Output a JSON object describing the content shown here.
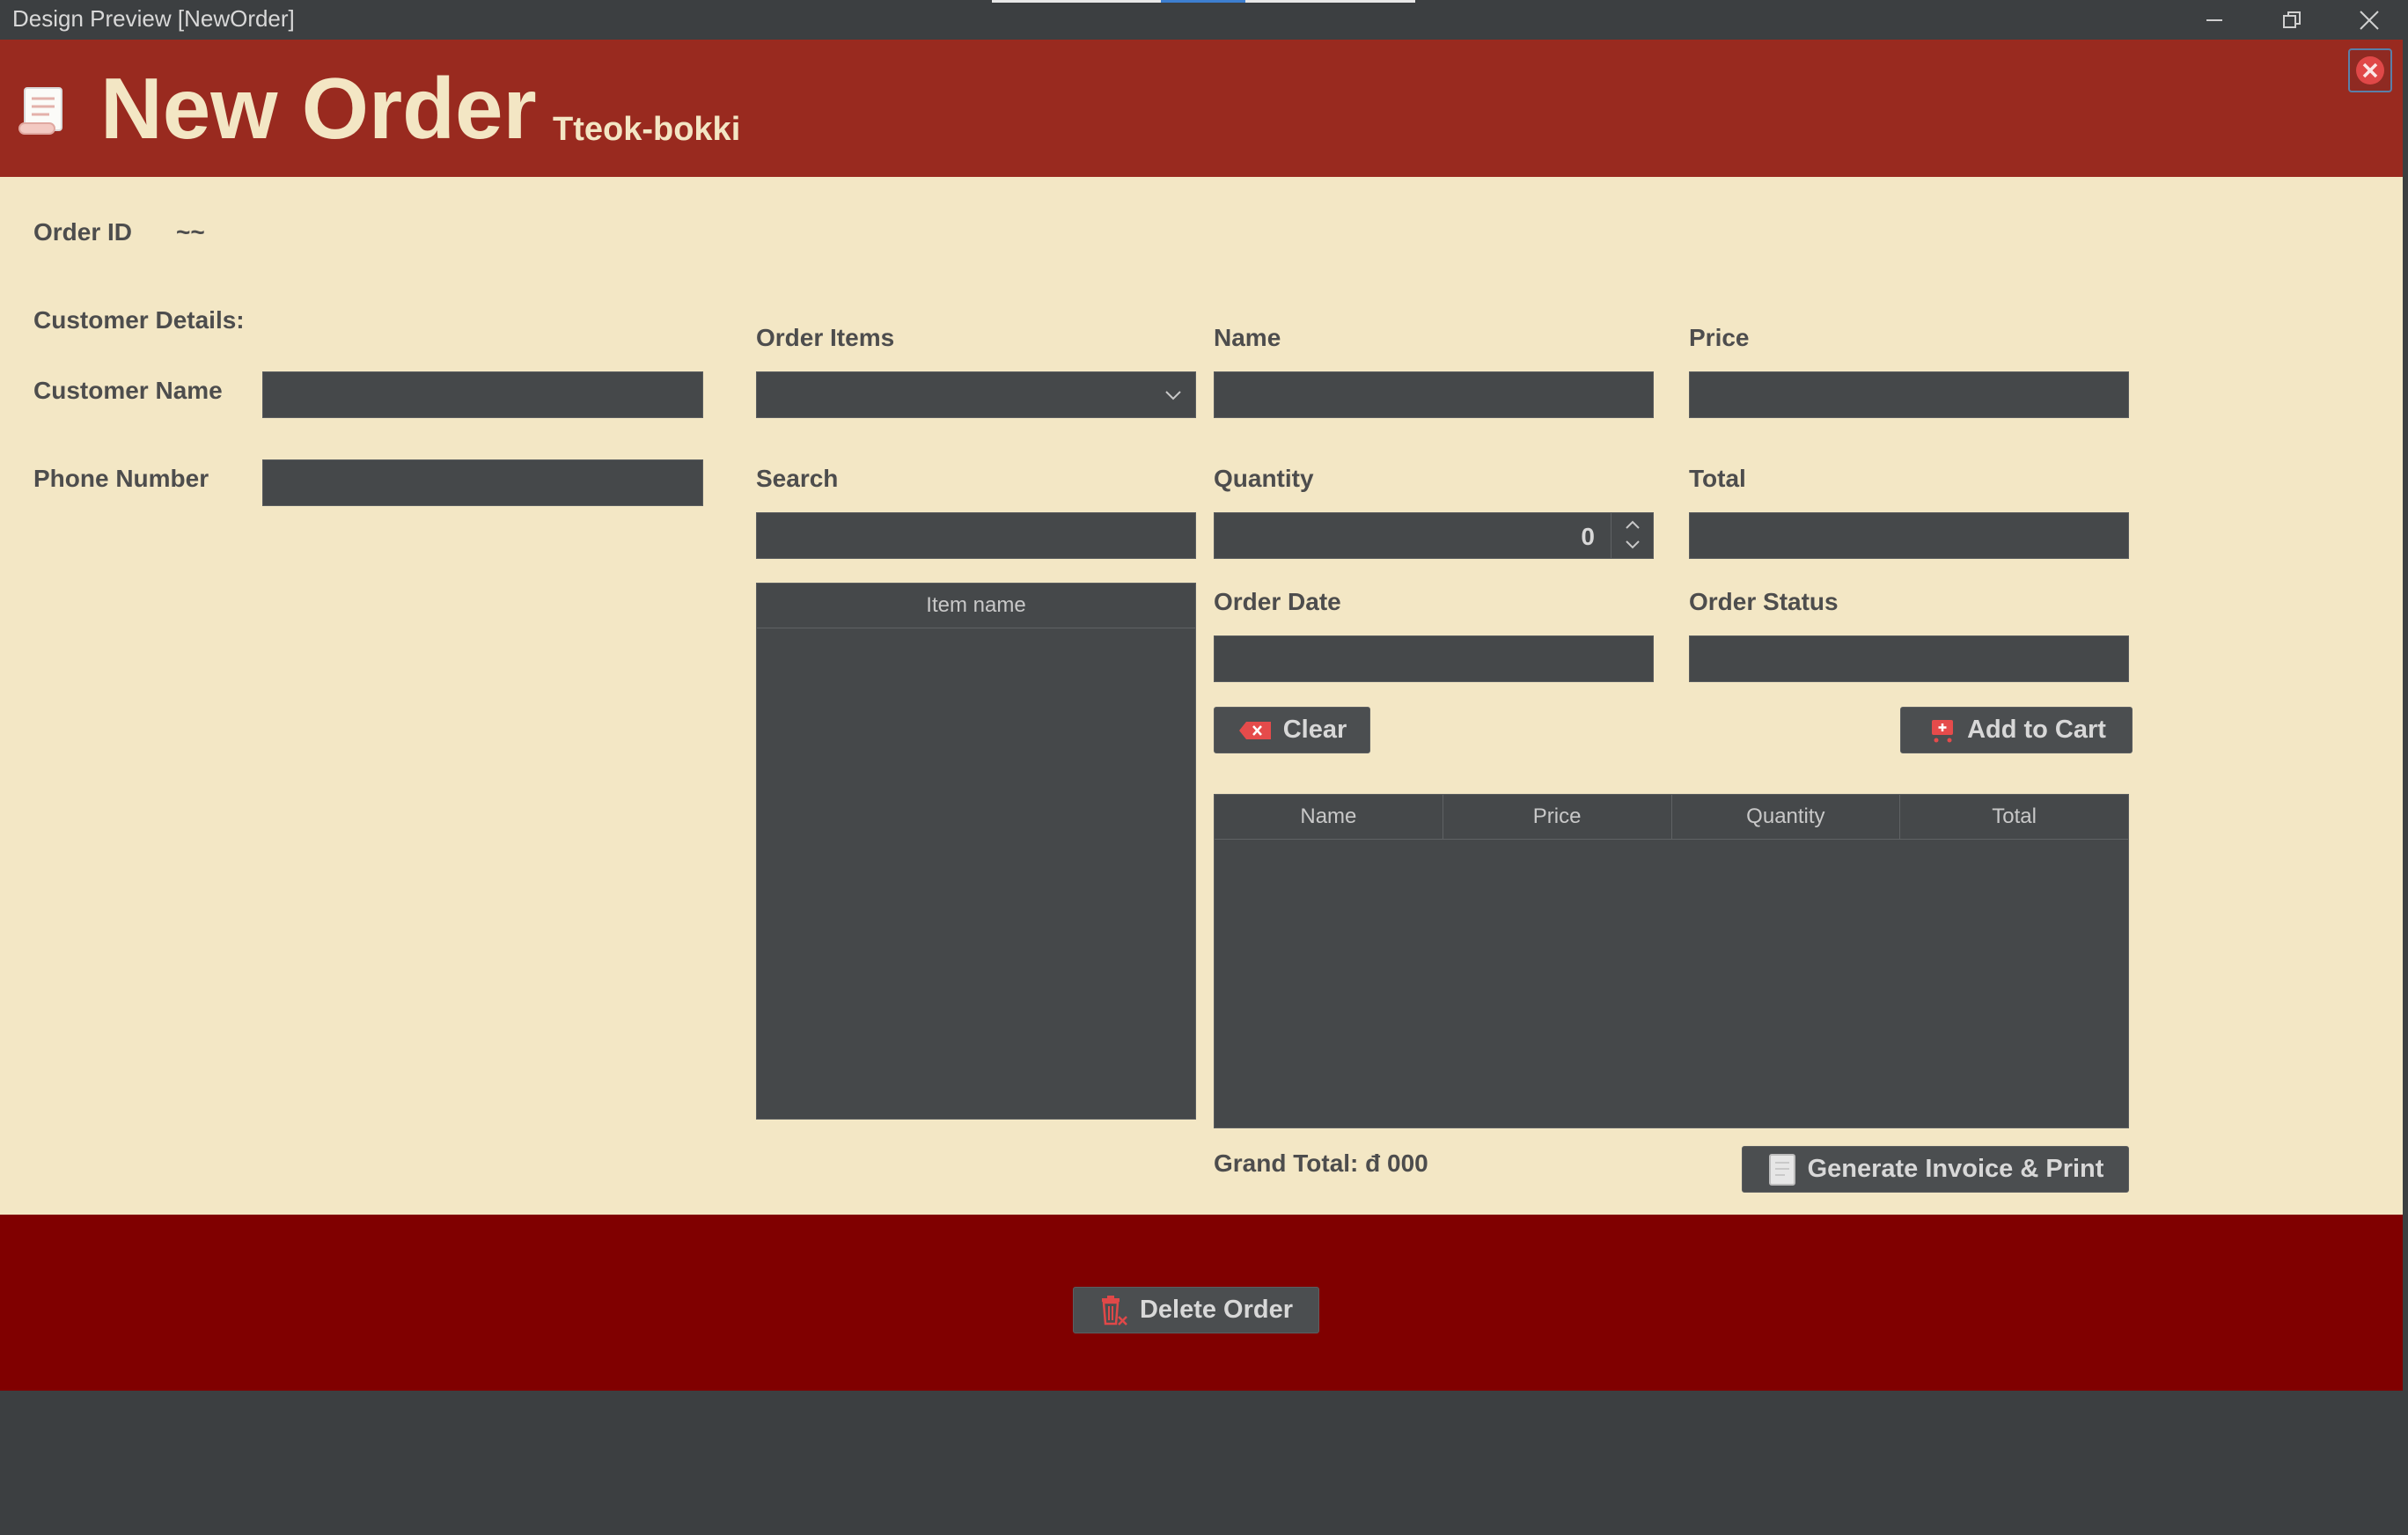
{
  "window": {
    "title": "Design Preview [NewOrder]",
    "minimize_icon": "minimize-icon",
    "restore_icon": "restore-icon",
    "close_icon": "close-icon"
  },
  "header": {
    "title": "New Order",
    "subtitle": "Tteok-bokki",
    "logo_icon": "receipt-scroll-icon",
    "close_icon": "close-circle-icon"
  },
  "order": {
    "id_label": "Order ID",
    "id_value": "~~"
  },
  "customer": {
    "section_label": "Customer Details:",
    "name_label": "Customer Name",
    "name_value": "",
    "phone_label": "Phone Number",
    "phone_value": ""
  },
  "items": {
    "order_items_label": "Order Items",
    "order_items_selected": "",
    "search_label": "Search",
    "search_value": "",
    "list_header": "Item name"
  },
  "detail": {
    "name_label": "Name",
    "name_value": "",
    "price_label": "Price",
    "price_value": "",
    "quantity_label": "Quantity",
    "quantity_value": "0",
    "total_label": "Total",
    "total_value": "",
    "order_date_label": "Order Date",
    "order_date_value": "",
    "order_status_label": "Order Status",
    "order_status_value": ""
  },
  "buttons": {
    "clear": "Clear",
    "add_to_cart": "Add to Cart",
    "generate_invoice": "Generate Invoice & Print",
    "delete_order": "Delete Order"
  },
  "cart": {
    "columns": [
      "Name",
      "Price",
      "Quantity",
      "Total"
    ],
    "rows": []
  },
  "grand_total": "Grand Total: đ  000",
  "colors": {
    "header_bg": "#992a1f",
    "panel_bg": "#f3e7c5",
    "footer_bg": "#800000",
    "field_bg": "#45484a"
  }
}
